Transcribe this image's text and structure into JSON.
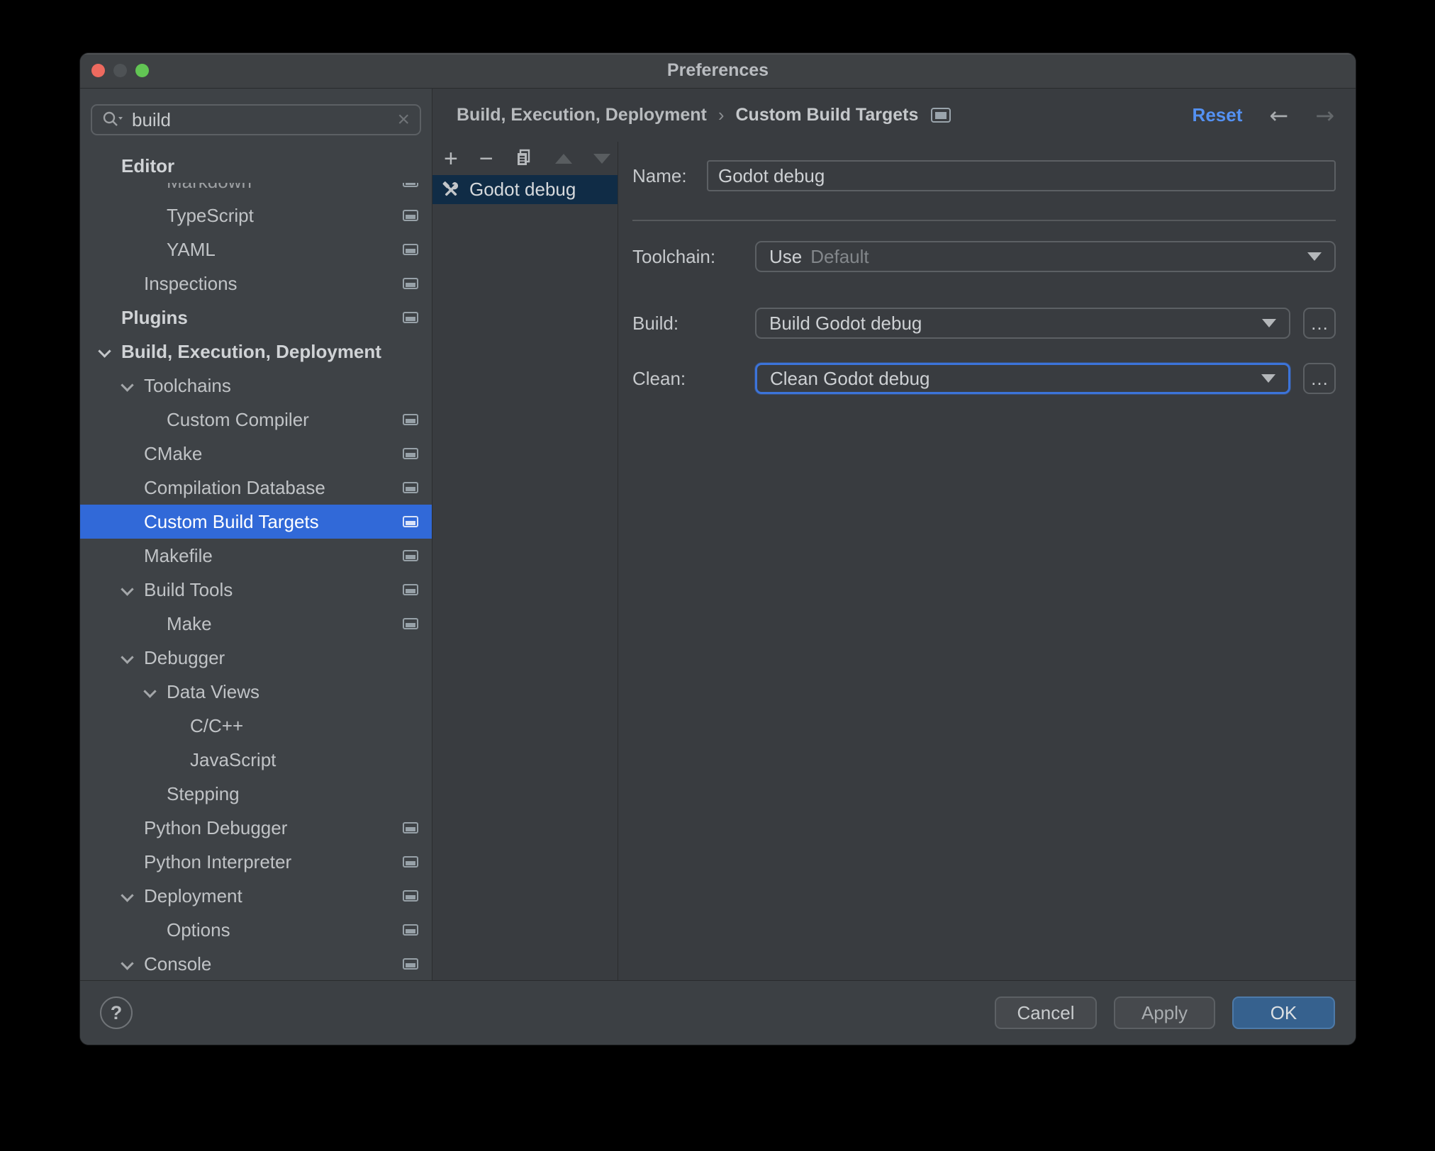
{
  "window": {
    "title": "Preferences"
  },
  "search": {
    "value": "build",
    "clear_glyph": "×"
  },
  "sidebar": {
    "items": [
      {
        "id": "editor",
        "label": "Editor",
        "level": 0,
        "bold": true
      },
      {
        "id": "markdown",
        "label": "Markdown",
        "level": 2,
        "icon": true,
        "clipped": true
      },
      {
        "id": "typescript",
        "label": "TypeScript",
        "level": 2,
        "icon": true
      },
      {
        "id": "yaml",
        "label": "YAML",
        "level": 2,
        "icon": true
      },
      {
        "id": "inspections",
        "label": "Inspections",
        "level": 1,
        "icon": true
      },
      {
        "id": "plugins",
        "label": "Plugins",
        "level": 0,
        "bold": true,
        "icon": true
      },
      {
        "id": "build-execution-deployment",
        "label": "Build, Execution, Deployment",
        "level": 0,
        "bold": true,
        "chevron": true
      },
      {
        "id": "toolchains",
        "label": "Toolchains",
        "level": 1,
        "chevron": true
      },
      {
        "id": "custom-compiler",
        "label": "Custom Compiler",
        "level": 2,
        "icon": true
      },
      {
        "id": "cmake",
        "label": "CMake",
        "level": 1,
        "icon": true
      },
      {
        "id": "compilation-database",
        "label": "Compilation Database",
        "level": 1,
        "icon": true
      },
      {
        "id": "custom-build-targets",
        "label": "Custom Build Targets",
        "level": 1,
        "icon": true,
        "selected": true
      },
      {
        "id": "makefile",
        "label": "Makefile",
        "level": 1,
        "icon": true
      },
      {
        "id": "build-tools",
        "label": "Build Tools",
        "level": 1,
        "chevron": true,
        "icon": true
      },
      {
        "id": "make",
        "label": "Make",
        "level": 2,
        "icon": true
      },
      {
        "id": "debugger",
        "label": "Debugger",
        "level": 1,
        "chevron": true
      },
      {
        "id": "data-views",
        "label": "Data Views",
        "level": 2,
        "chevron": true
      },
      {
        "id": "c-cpp",
        "label": "C/C++",
        "level": 3
      },
      {
        "id": "javascript",
        "label": "JavaScript",
        "level": 3
      },
      {
        "id": "stepping",
        "label": "Stepping",
        "level": 2
      },
      {
        "id": "python-debugger",
        "label": "Python Debugger",
        "level": 1,
        "icon": true
      },
      {
        "id": "python-interpreter",
        "label": "Python Interpreter",
        "level": 1,
        "icon": true
      },
      {
        "id": "deployment",
        "label": "Deployment",
        "level": 1,
        "chevron": true,
        "icon": true
      },
      {
        "id": "options",
        "label": "Options",
        "level": 2,
        "icon": true
      },
      {
        "id": "console",
        "label": "Console",
        "level": 1,
        "chevron": true,
        "icon": true
      }
    ]
  },
  "middle": {
    "toolbar_icons": [
      "add",
      "remove",
      "duplicate",
      "move-up",
      "move-down"
    ],
    "items": [
      {
        "label": "Godot debug"
      }
    ]
  },
  "breadcrumb": {
    "part1": "Build, Execution, Deployment",
    "separator": "›",
    "part2": "Custom Build Targets"
  },
  "header": {
    "reset_label": "Reset",
    "back_glyph": "←",
    "forward_glyph": "→"
  },
  "form": {
    "name_label": "Name:",
    "name_value": "Godot debug",
    "toolchain_label": "Toolchain:",
    "toolchain_use": "Use",
    "toolchain_value": "Default",
    "build_label": "Build:",
    "build_value": "Build Godot debug",
    "clean_label": "Clean:",
    "clean_value": "Clean Godot debug",
    "more_label": "…"
  },
  "footer": {
    "help": "?",
    "cancel": "Cancel",
    "apply": "Apply",
    "ok": "OK"
  },
  "colors": {
    "selection_blue": "#3169d8",
    "unfocused_selection": "#102c46",
    "focus_ring": "#3c74da",
    "link_blue": "#5491f2",
    "ok_button": "#36618e",
    "traffic_red": "#ed6a5f",
    "traffic_middle": "#4e5255",
    "traffic_green": "#62c554"
  }
}
